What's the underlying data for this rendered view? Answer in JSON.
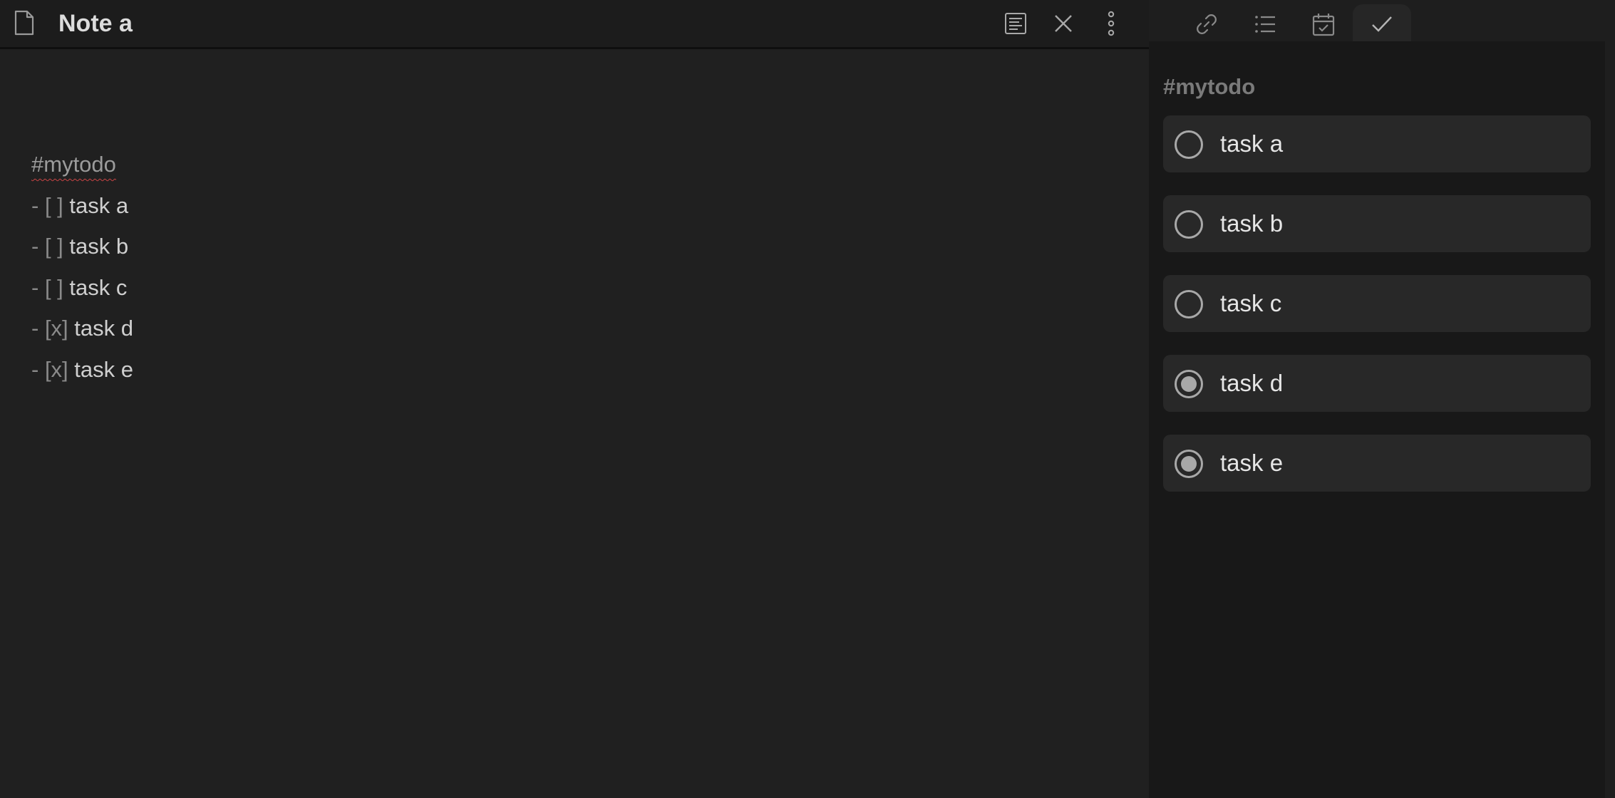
{
  "note": {
    "title": "Note a",
    "file_icon": "file-icon",
    "toolbar_icons": [
      "reading-view-icon",
      "close-icon",
      "more-options-icon"
    ],
    "lines": [
      {
        "type": "tag",
        "text": "#mytodo"
      },
      {
        "type": "task",
        "prefix": "- ",
        "box": "[ ]",
        "text": " task a"
      },
      {
        "type": "task",
        "prefix": "- ",
        "box": "[ ]",
        "text": " task b"
      },
      {
        "type": "task",
        "prefix": "- ",
        "box": "[ ]",
        "text": " task c"
      },
      {
        "type": "task",
        "prefix": "- ",
        "box": "[x]",
        "text": " task d"
      },
      {
        "type": "task",
        "prefix": "- ",
        "box": "[x]",
        "text": " task e"
      }
    ]
  },
  "sidebar": {
    "tabs": [
      {
        "icon": "link-icon",
        "active": false
      },
      {
        "icon": "list-icon",
        "active": false
      },
      {
        "icon": "calendar-check-icon",
        "active": false
      },
      {
        "icon": "checkmark-icon",
        "active": true
      }
    ],
    "heading": "#mytodo",
    "tasks": [
      {
        "label": "task a",
        "done": false
      },
      {
        "label": "task b",
        "done": false
      },
      {
        "label": "task c",
        "done": false
      },
      {
        "label": "task d",
        "done": true
      },
      {
        "label": "task e",
        "done": true
      }
    ]
  },
  "colors": {
    "editor_bg": "#202020",
    "sidebar_bg": "#181818",
    "task_card_bg": "#282828",
    "tag_squiggle": "#c94444"
  }
}
